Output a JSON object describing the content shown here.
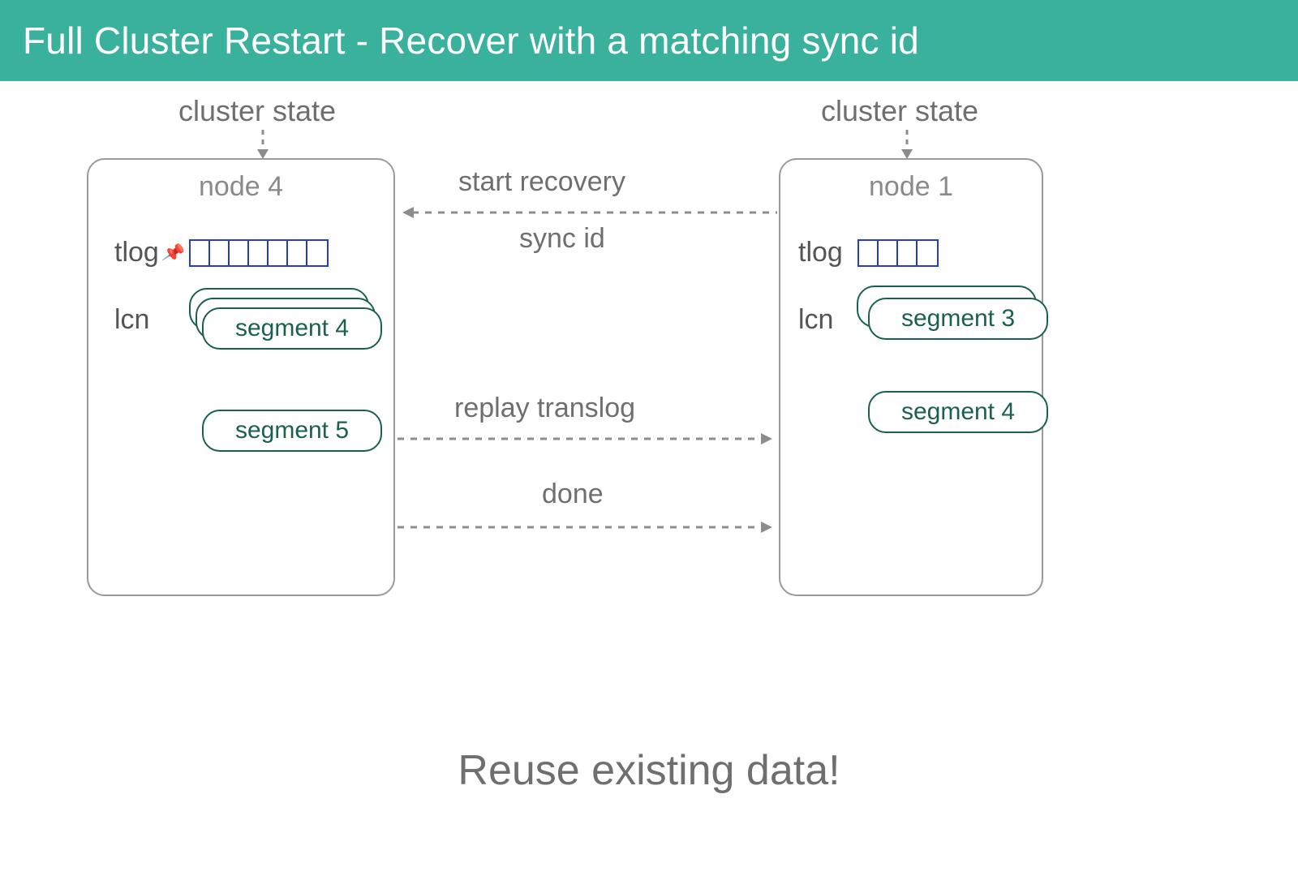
{
  "title": "Full Cluster Restart - Recover with a matching sync id",
  "cluster_state": "cluster state",
  "node4": {
    "label": "node 4",
    "tlog": "tlog",
    "lcn": "lcn",
    "tlog_cells": 7,
    "segments": [
      "segment 4",
      "segment 5"
    ]
  },
  "node1": {
    "label": "node 1",
    "tlog": "tlog",
    "lcn": "lcn",
    "tlog_cells": 4,
    "segments": [
      "segment 3",
      "segment 4"
    ]
  },
  "flows": {
    "start": "start recovery",
    "sync": "sync id",
    "translog": "replay translog",
    "done": "done"
  },
  "footer": "Reuse existing data!"
}
